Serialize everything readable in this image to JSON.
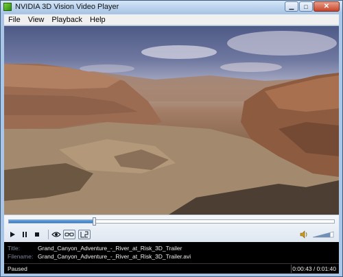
{
  "window": {
    "title": "NVIDIA 3D Vision Video Player",
    "controls": {
      "minimize": "minimize",
      "maximize": "maximize",
      "close": "close"
    }
  },
  "menu": [
    {
      "label": "File",
      "accel": "F"
    },
    {
      "label": "View",
      "accel": "V"
    },
    {
      "label": "Playback",
      "accel": "P"
    },
    {
      "label": "Help",
      "accel": "H"
    }
  ],
  "player": {
    "progress_fraction": 0.2625,
    "volume_fraction": 0.85,
    "buttons": [
      "play",
      "pause",
      "stop",
      "eye-3d",
      "stereo-glasses",
      "left-right-mode"
    ]
  },
  "info": {
    "title_label": "Title:",
    "title_value": "Grand_Canyon_Adventure_-_River_at_Risk_3D_Trailer",
    "filename_label": "Filename:",
    "filename_value": "Grand_Canyon_Adventure_-_River_at_Risk_3D_Trailer.avi"
  },
  "status": {
    "state": "Paused",
    "time": "0:00:43 / 0:01:40"
  },
  "colors": {
    "accent": "#2f78c8",
    "info_bg": "#000000",
    "label": "#7d8796"
  }
}
